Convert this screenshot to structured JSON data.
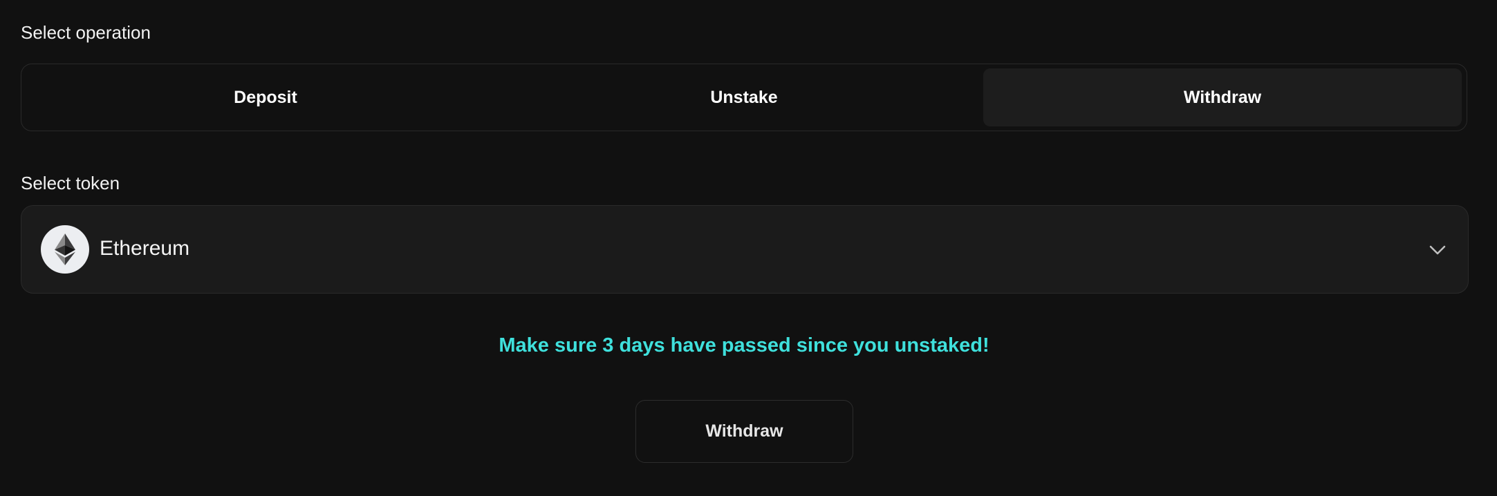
{
  "operation": {
    "label": "Select operation",
    "options": [
      {
        "label": "Deposit",
        "selected": false
      },
      {
        "label": "Unstake",
        "selected": false
      },
      {
        "label": "Withdraw",
        "selected": true
      }
    ]
  },
  "token": {
    "label": "Select token",
    "selected_name": "Ethereum",
    "icon": "ethereum-icon",
    "dropdown_icon": "chevron-down-icon"
  },
  "notice": {
    "text": "Make sure 3 days have passed since you unstaked!",
    "color": "#3fe0dc"
  },
  "action": {
    "button_label": "Withdraw"
  },
  "colors": {
    "background": "#111111",
    "surface": "#1b1b1b",
    "border": "#2a2a2a",
    "accent": "#3fe0dc"
  }
}
